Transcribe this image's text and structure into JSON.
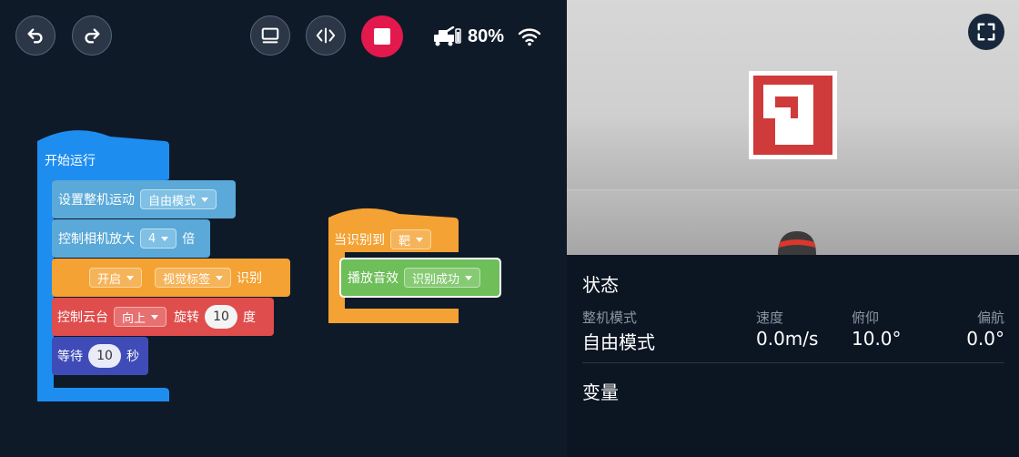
{
  "toolbar": {
    "undo_icon": "undo-icon",
    "redo_icon": "redo-icon",
    "screen_icon": "monitor-icon",
    "code_icon": "code-icon",
    "stop_icon": "stop-icon",
    "battery_percent": "80%"
  },
  "blocks": {
    "start": {
      "label": "开始运行"
    },
    "chassis_mode": {
      "label": "设置整机运动",
      "value": "自由模式"
    },
    "zoom": {
      "label": "控制相机放大",
      "value": "4",
      "suffix": "倍"
    },
    "recognize": {
      "state": "开启",
      "target": "视觉标签",
      "suffix": "识别"
    },
    "gimbal": {
      "label": "控制云台",
      "direction": "向上",
      "rotate_label": "旋转",
      "value": "10",
      "unit": "度"
    },
    "wait": {
      "label": "等待",
      "value": "10",
      "unit": "秒"
    },
    "on_detect": {
      "label": "当识别到",
      "value": "靶"
    },
    "play_sound": {
      "label": "播放音效",
      "value": "识别成功"
    }
  },
  "panel": {
    "status_title": "状态",
    "stats": [
      {
        "label": "整机模式",
        "value": "自由模式"
      },
      {
        "label": "速度",
        "value": "0.0m/s"
      },
      {
        "label": "俯仰",
        "value": "10.0°"
      },
      {
        "label": "偏航",
        "value": "0.0°"
      }
    ],
    "variables_title": "变量"
  },
  "colors": {
    "workspace_bg": "#0f1a29",
    "event_blue": "#1e8df0",
    "chassis_lightblue": "#5aa9d8",
    "vision_orange": "#f3a233",
    "gimbal_red": "#e04d4d",
    "control_indigo": "#3f4cb8",
    "sound_green": "#6ebe5a",
    "stop_red": "#e3194d"
  }
}
